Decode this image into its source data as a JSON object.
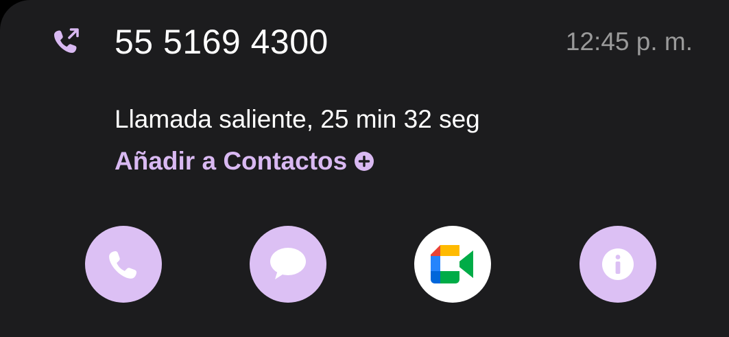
{
  "call": {
    "number": "55 5169 4300",
    "time": "12:45 p. m.",
    "detail": "Llamada saliente, 25 min 32 seg",
    "type_icon": "outgoing-call-icon"
  },
  "add_contact": {
    "label": "Añadir a Contactos",
    "icon": "plus-circle-icon"
  },
  "actions": [
    {
      "name": "call",
      "icon": "phone-icon"
    },
    {
      "name": "message",
      "icon": "chat-bubble-icon"
    },
    {
      "name": "video-call",
      "icon": "google-meet-icon"
    },
    {
      "name": "info",
      "icon": "info-icon"
    }
  ],
  "colors": {
    "background": "#1c1c1e",
    "accent": "#d9b9f2",
    "button_fill": "#dcc0f4",
    "text_primary": "#ffffff",
    "text_secondary": "#9a9a9a"
  }
}
